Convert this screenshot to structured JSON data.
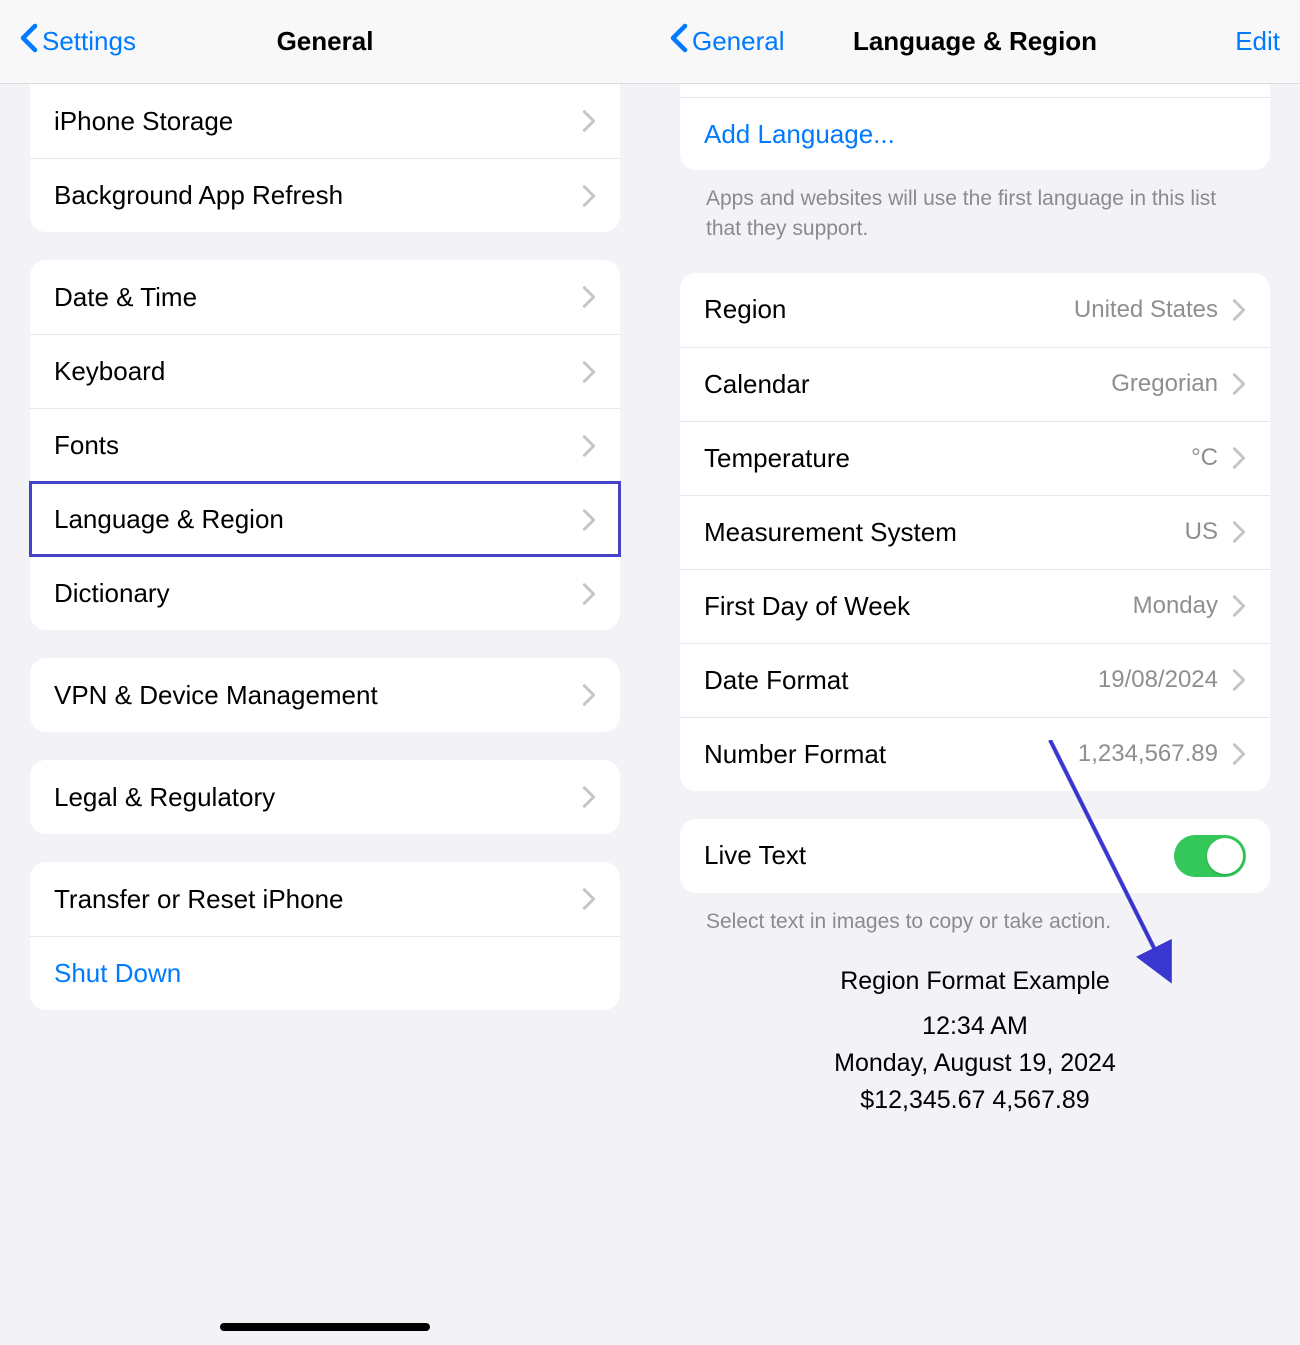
{
  "left": {
    "back_label": "Settings",
    "title": "General",
    "group1": [
      {
        "label": "iPhone Storage"
      },
      {
        "label": "Background App Refresh"
      }
    ],
    "group2": [
      {
        "label": "Date & Time"
      },
      {
        "label": "Keyboard"
      },
      {
        "label": "Fonts"
      },
      {
        "label": "Language & Region",
        "highlight": true
      },
      {
        "label": "Dictionary"
      }
    ],
    "group3": [
      {
        "label": "VPN & Device Management"
      }
    ],
    "group4": [
      {
        "label": "Legal & Regulatory"
      }
    ],
    "group5": [
      {
        "label": "Transfer or Reset iPhone"
      },
      {
        "label": "Shut Down",
        "link": true
      }
    ]
  },
  "right": {
    "back_label": "General",
    "title": "Language & Region",
    "edit_label": "Edit",
    "add_language_label": "Add Language...",
    "lang_footer": "Apps and websites will use the first language in this list that they support.",
    "rows": [
      {
        "label": "Region",
        "value": "United States"
      },
      {
        "label": "Calendar",
        "value": "Gregorian"
      },
      {
        "label": "Temperature",
        "value": "°C"
      },
      {
        "label": "Measurement System",
        "value": "US"
      },
      {
        "label": "First Day of Week",
        "value": "Monday"
      },
      {
        "label": "Date Format",
        "value": "19/08/2024"
      },
      {
        "label": "Number Format",
        "value": "1,234,567.89"
      }
    ],
    "live_text_label": "Live Text",
    "live_text_on": true,
    "live_text_footer": "Select text in images to copy or take action.",
    "example": {
      "title": "Region Format Example",
      "time": "12:34 AM",
      "date": "Monday, August 19, 2024",
      "money": "$12,345.67   4,567.89"
    }
  }
}
